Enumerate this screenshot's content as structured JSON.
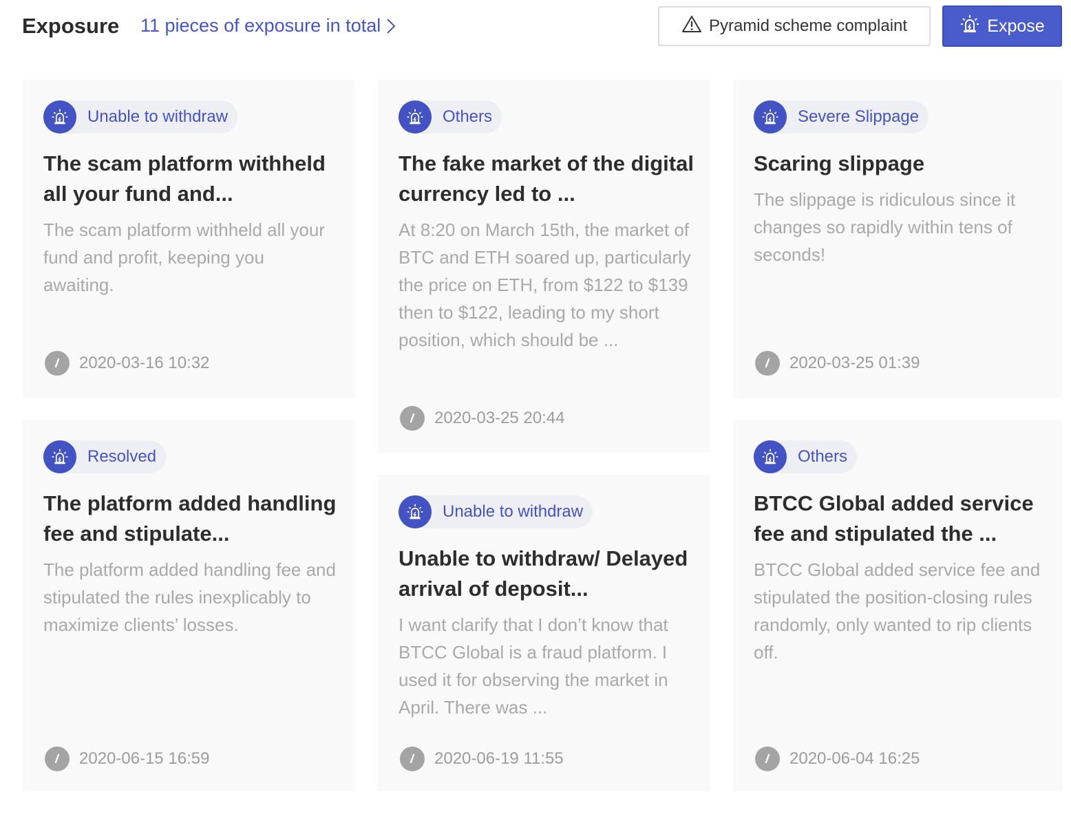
{
  "header": {
    "title": "Exposure",
    "total_link": "11 pieces of exposure in total",
    "complaint_button": "Pyramid scheme complaint",
    "expose_button": "Expose"
  },
  "colors": {
    "accent": "#4453c4",
    "card_bg": "#f9f9fa",
    "muted_text": "#a9a9a9"
  },
  "cards": [
    {
      "tag": "Unable to withdraw",
      "title": "The scam platform withheld all your fund and...",
      "desc": "The scam platform withheld all your fund and profit, keeping you awaiting.",
      "time": "2020-03-16 10:32"
    },
    {
      "tag": "Others",
      "title": "The fake market of the digital currency led to ...",
      "desc": "At 8:20 on March 15th, the market of BTC and ETH soared up, particularly the price on ETH, from $122 to $139 then to $122, leading to my short position, which should be ...",
      "time": "2020-03-25 20:44"
    },
    {
      "tag": "Severe Slippage",
      "title": "Scaring slippage",
      "desc": "The slippage is ridiculous since it changes so rapidly within tens of seconds!",
      "time": "2020-03-25 01:39"
    },
    {
      "tag": "Resolved",
      "title": "The platform added handling fee and stipulate...",
      "desc": "The platform added handling fee and stipulated the rules inexplicably to maximize clients’ losses.",
      "time": "2020-06-15 16:59"
    },
    {
      "tag": "Unable to withdraw",
      "title": "Unable to withdraw/ Delayed arrival of deposit...",
      "desc": "I want clarify that I don’t know that BTCC Global is a fraud platform. I used it for observing the market in April. There was ...",
      "time": "2020-06-19 11:55"
    },
    {
      "tag": "Others",
      "title": "BTCC Global added service fee and stipulated the ...",
      "desc": "BTCC Global added service fee and stipulated the position-closing rules randomly, only wanted to rip clients off.",
      "time": "2020-06-04 16:25"
    }
  ]
}
